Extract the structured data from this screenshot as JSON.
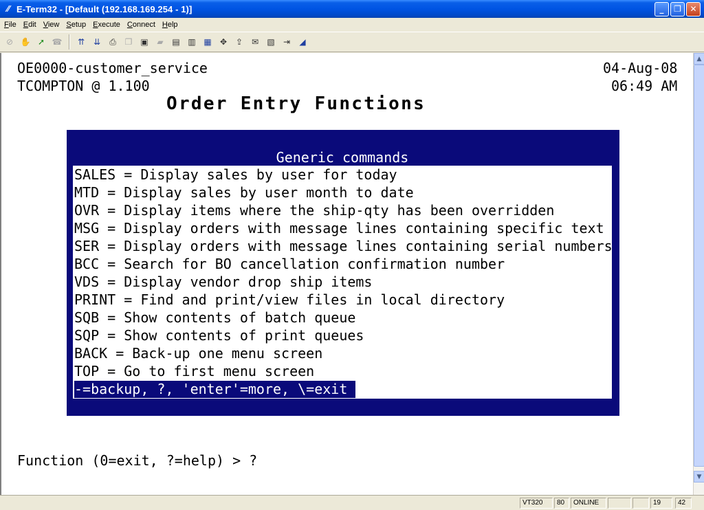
{
  "window": {
    "title": "E-Term32 - [Default (192.168.169.254 - 1)]",
    "min_glyph": "_",
    "max_glyph": "❐",
    "close_glyph": "✕"
  },
  "menubar": [
    "File",
    "Edit",
    "View",
    "Setup",
    "Execute",
    "Connect",
    "Help"
  ],
  "toolbar": {
    "icons": [
      "no-icon",
      "hand-icon",
      "connect-icon",
      "disconnect-icon",
      "send-icon",
      "receive-icon",
      "print-icon",
      "copy-icon",
      "paste-icon",
      "clipboard-icon",
      "log-icon",
      "capture-icon",
      "keypad-icon",
      "settings-icon",
      "transfer-icon",
      "macro-icon",
      "script-icon",
      "exit-icon",
      "edit-icon"
    ]
  },
  "terminal": {
    "program": "OE0000-customer_service",
    "user_line": "TCOMPTON @ 1.100",
    "date": "04-Aug-08",
    "time": "06:49 AM",
    "heading": "Order Entry Functions",
    "menu": {
      "header": "Generic commands",
      "items": [
        "SALES = Display sales by user for today",
        "MTD = Display sales by user month to date",
        "OVR = Display items where the ship-qty has been overridden",
        "MSG = Display orders with message lines containing specific text",
        "SER = Display orders with message lines containing serial numbers",
        "BCC = Search for BO cancellation confirmation number",
        "VDS = Display vendor drop ship items",
        "PRINT = Find and print/view files in local directory",
        "SQB = Show contents of batch queue",
        "SQP = Show contents of print queues",
        "BACK = Back-up one menu screen",
        "TOP = Go to first menu screen"
      ],
      "footer": "-=backup, ?, 'enter'=more, \\=exit"
    },
    "prompt": "Function (0=exit, ?=help) > ?"
  },
  "statusbar": {
    "emulation": "VT320",
    "columns": "80",
    "state": "ONLINE",
    "blank1": "",
    "blank2": "",
    "row": "19",
    "col": "42"
  }
}
